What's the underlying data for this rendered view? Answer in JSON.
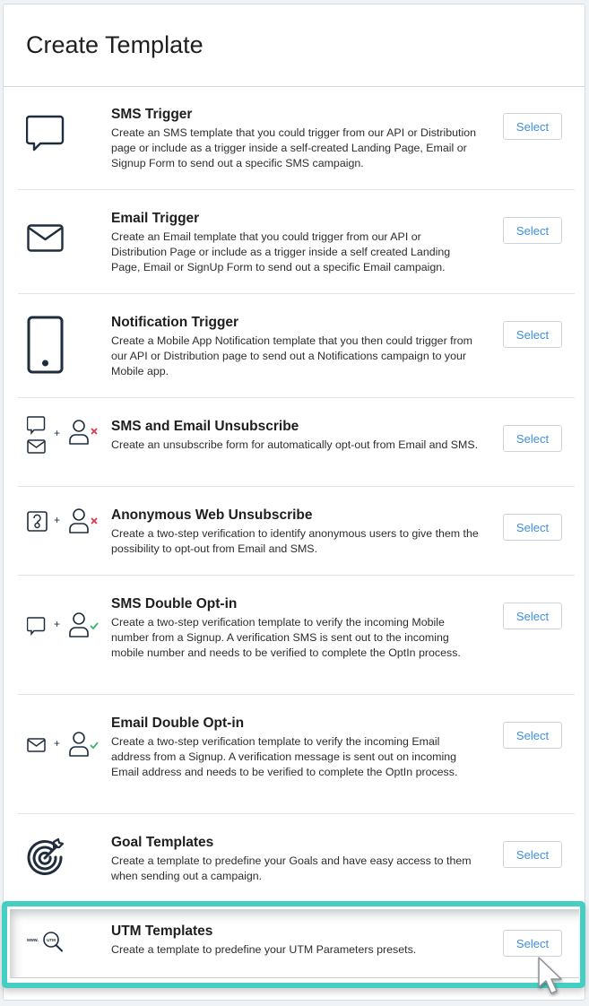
{
  "dialog": {
    "title": "Create Template"
  },
  "colors": {
    "accent_blue": "#3b8fe0",
    "icon_dark": "#1f2d3d",
    "error_red": "#e0354f",
    "success_green": "#3cb371",
    "highlight_teal": "#45cfc3"
  },
  "templates": [
    {
      "title": "SMS Trigger",
      "description": "Create an SMS template that you could trigger from our API or Distribution page or include as a trigger inside a self-created Landing Page, Email or Signup Form to send out a specific SMS campaign.",
      "icon": "chat-bubble-icon",
      "button": "Select"
    },
    {
      "title": "Email Trigger",
      "description": "Create an Email template that you could trigger from our API or Distribution Page or include as a trigger inside a self created Landing Page, Email or SignUp Form to send out a specific Email campaign.",
      "icon": "envelope-icon",
      "button": "Select"
    },
    {
      "title": "Notification Trigger",
      "description": "Create a Mobile App Notification template that you then could trigger from our API or Distribution page to send out a Notifications campaign to your Mobile app.",
      "icon": "mobile-phone-icon",
      "button": "Select"
    },
    {
      "title": "SMS and Email Unsubscribe",
      "description": "Create an unsubscribe form for automatically opt-out from Email and SMS.",
      "icon": "chat-envelope-plus-user-remove-icon",
      "button": "Select"
    },
    {
      "title": "Anonymous Web Unsubscribe",
      "description": "Create a two-step verification to identify anonymous users to give them the possibility to opt-out from Email and SMS.",
      "icon": "question-plus-user-remove-icon",
      "button": "Select"
    },
    {
      "title": "SMS Double Opt-in",
      "description": "Create a two-step verification template to verify the incoming Mobile number from a Signup. A verification SMS is sent out to the incoming mobile number and needs to be verified to complete the OptIn process.",
      "icon": "chat-plus-user-check-icon",
      "button": "Select"
    },
    {
      "title": "Email Double Opt-in",
      "description": "Create a two-step verification template to verify the incoming Email address from a Signup. A verification message is sent out on incoming Email address and needs to be verified to complete the OptIn process.",
      "icon": "envelope-plus-user-check-icon",
      "button": "Select"
    },
    {
      "title": "Goal Templates",
      "description": "Create a template to predefine your Goals and have easy access to them when sending out a campaign.",
      "icon": "target-icon",
      "button": "Select"
    },
    {
      "title": "UTM Templates",
      "description": "Create a template to predefine your UTM Parameters presets.",
      "icon": "utm-search-icon",
      "button": "Select",
      "highlighted": true
    }
  ],
  "icon_text": {
    "plus": "+",
    "utm_www": "www.",
    "utm_label": "UTM"
  }
}
